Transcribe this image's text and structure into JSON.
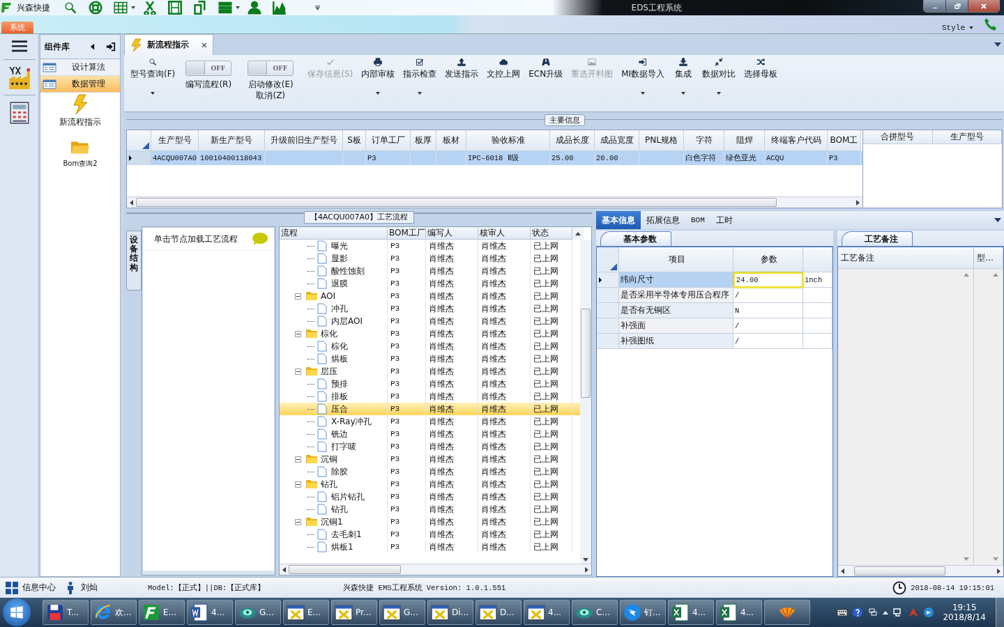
{
  "title_bar": {
    "app_name": "兴森快捷",
    "title": "EDS工程系统"
  },
  "ribbon": {
    "tabs": [
      {
        "label": "系统",
        "selected": true
      }
    ],
    "style_menu": "Style"
  },
  "component_panel": {
    "title": "组件库",
    "groups": [
      {
        "label": "设计算法",
        "selected": false
      },
      {
        "label": "数据管理",
        "selected": true
      }
    ],
    "items": [
      {
        "label": "新流程指示",
        "kind": "flow"
      },
      {
        "label": "Bom查询2",
        "kind": "query"
      }
    ]
  },
  "document_tabs": [
    {
      "label": "新流程指示",
      "selected": true
    }
  ],
  "toolbar": [
    {
      "kind": "button",
      "label": "型号查询(F)",
      "dropdown": true,
      "disabled": false
    },
    {
      "kind": "toggle",
      "label": "编写流程(R)",
      "on": false,
      "state_text": "OFF"
    },
    {
      "kind": "toggle",
      "label": "启动修改(E) 取消(Z)",
      "on": false,
      "state_text": "OFF"
    },
    {
      "kind": "button",
      "label": "保存信息(S)",
      "dropdown": false,
      "disabled": true
    },
    {
      "kind": "button",
      "label": "内部审核",
      "dropdown": true,
      "disabled": false
    },
    {
      "kind": "button",
      "label": "指示检查",
      "dropdown": true,
      "disabled": false
    },
    {
      "kind": "button",
      "label": "发送指示",
      "dropdown": false,
      "disabled": false
    },
    {
      "kind": "button",
      "label": "文控上网",
      "dropdown": false,
      "disabled": false
    },
    {
      "kind": "button",
      "label": "ECN升级",
      "dropdown": false,
      "disabled": false
    },
    {
      "kind": "button",
      "label": "重选开料图",
      "dropdown": false,
      "disabled": true
    },
    {
      "kind": "button",
      "label": "MI数据导入",
      "dropdown": true,
      "disabled": false
    },
    {
      "kind": "button",
      "label": "集成",
      "dropdown": true,
      "disabled": false
    },
    {
      "kind": "button",
      "label": "数据对比",
      "dropdown": true,
      "disabled": false
    },
    {
      "kind": "button",
      "label": "选择母板",
      "dropdown": false,
      "disabled": false
    }
  ],
  "main_info": {
    "legend": "主要信息",
    "columns": [
      "生产型号",
      "新生产型号",
      "升级前旧生产型号",
      "S板",
      "订单工厂",
      "板厚",
      "板材",
      "验收标准",
      "成品长度",
      "成品宽度",
      "PNL规格",
      "字符",
      "阻焊",
      "终端客户代码",
      "BOM工"
    ],
    "rows": [
      {
        "selected": true,
        "cells": [
          "4ACQU007A0",
          "10010400118043",
          null,
          null,
          "P3",
          null,
          null,
          "IPC-6018 Ⅱ级",
          "25.00",
          "20.00",
          null,
          "白色字符",
          "绿色亚光",
          "ACQU",
          "P3"
        ]
      }
    ],
    "side_columns": [
      "合拼型号",
      "生产型号"
    ]
  },
  "flow": {
    "title": "【4ACQU007A0】工艺流程",
    "side_tab": "设备结构",
    "hint": "单击节点加载工艺流程",
    "columns": [
      "流程",
      "BOM工厂",
      "编写人",
      "核审人",
      "状态"
    ],
    "rows": [
      {
        "kind": "step",
        "name": "曝光",
        "factory": "P3",
        "author": "肖维杰",
        "reviewer": "肖维杰",
        "status": "已上网",
        "selected": false
      },
      {
        "kind": "step",
        "name": "显影",
        "factory": "P3",
        "author": "肖维杰",
        "reviewer": "肖维杰",
        "status": "已上网",
        "selected": false
      },
      {
        "kind": "step",
        "name": "酸性蚀刻",
        "factory": "P3",
        "author": "肖维杰",
        "reviewer": "肖维杰",
        "status": "已上网",
        "selected": false
      },
      {
        "kind": "step",
        "name": "退膜",
        "factory": "P3",
        "author": "肖维杰",
        "reviewer": "肖维杰",
        "status": "已上网",
        "selected": false
      },
      {
        "kind": "group",
        "name": "AOI",
        "factory": "P3",
        "author": "肖维杰",
        "reviewer": "肖维杰",
        "status": "已上网",
        "selected": false,
        "expanded": true,
        "children": [
          {
            "kind": "step",
            "name": "冲孔",
            "factory": "P3",
            "author": "肖维杰",
            "reviewer": "肖维杰",
            "status": "已上网",
            "selected": false
          },
          {
            "kind": "step",
            "name": "内层AOI",
            "factory": "P3",
            "author": "肖维杰",
            "reviewer": "肖维杰",
            "status": "已上网",
            "selected": false
          }
        ]
      },
      {
        "kind": "group",
        "name": "棕化",
        "factory": "P3",
        "author": "肖维杰",
        "reviewer": "肖维杰",
        "status": "已上网",
        "selected": false,
        "expanded": true,
        "children": [
          {
            "kind": "step",
            "name": "棕化",
            "factory": "P3",
            "author": "肖维杰",
            "reviewer": "肖维杰",
            "status": "已上网",
            "selected": false
          },
          {
            "kind": "step",
            "name": "烘板",
            "factory": "P3",
            "author": "肖维杰",
            "reviewer": "肖维杰",
            "status": "已上网",
            "selected": false
          }
        ]
      },
      {
        "kind": "group",
        "name": "层压",
        "factory": "P3",
        "author": "肖维杰",
        "reviewer": "肖维杰",
        "status": "已上网",
        "selected": false,
        "expanded": true,
        "children": [
          {
            "kind": "step",
            "name": "预排",
            "factory": "P3",
            "author": "肖维杰",
            "reviewer": "肖维杰",
            "status": "已上网",
            "selected": false
          },
          {
            "kind": "step",
            "name": "排板",
            "factory": "P3",
            "author": "肖维杰",
            "reviewer": "肖维杰",
            "status": "已上网",
            "selected": false
          },
          {
            "kind": "step",
            "name": "压合",
            "factory": "P3",
            "author": "肖维杰",
            "reviewer": "肖维杰",
            "status": "已上网",
            "selected": true
          },
          {
            "kind": "step",
            "name": "X-Ray冲孔",
            "factory": "P3",
            "author": "肖维杰",
            "reviewer": "肖维杰",
            "status": "已上网",
            "selected": false
          },
          {
            "kind": "step",
            "name": "铣边",
            "factory": "P3",
            "author": "肖维杰",
            "reviewer": "肖维杰",
            "status": "已上网",
            "selected": false
          },
          {
            "kind": "step",
            "name": "打字唛",
            "factory": "P3",
            "author": "肖维杰",
            "reviewer": "肖维杰",
            "status": "已上网",
            "selected": false
          }
        ]
      },
      {
        "kind": "group",
        "name": "沉铜",
        "factory": "P3",
        "author": "肖维杰",
        "reviewer": "肖维杰",
        "status": "已上网",
        "selected": false,
        "expanded": true,
        "children": [
          {
            "kind": "step",
            "name": "除胶",
            "factory": "P3",
            "author": "肖维杰",
            "reviewer": "肖维杰",
            "status": "已上网",
            "selected": false
          }
        ]
      },
      {
        "kind": "group",
        "name": "钻孔",
        "factory": "P3",
        "author": "肖维杰",
        "reviewer": "肖维杰",
        "status": "已上网",
        "selected": false,
        "expanded": true,
        "children": [
          {
            "kind": "step",
            "name": "铝片钻孔",
            "factory": "P3",
            "author": "肖维杰",
            "reviewer": "肖维杰",
            "status": "已上网",
            "selected": false
          },
          {
            "kind": "step",
            "name": "钻孔",
            "factory": "P3",
            "author": "肖维杰",
            "reviewer": "肖维杰",
            "status": "已上网",
            "selected": false
          }
        ]
      },
      {
        "kind": "group",
        "name": "沉铜1",
        "factory": "P3",
        "author": "肖维杰",
        "reviewer": "肖维杰",
        "status": "已上网",
        "selected": false,
        "expanded": true,
        "children": [
          {
            "kind": "step",
            "name": "去毛刺1",
            "factory": "P3",
            "author": "肖维杰",
            "reviewer": "肖维杰",
            "status": "已上网",
            "selected": false
          },
          {
            "kind": "step",
            "name": "烘板1",
            "factory": "P3",
            "author": "肖维杰",
            "reviewer": "肖维杰",
            "status": "已上网",
            "selected": false
          }
        ]
      }
    ]
  },
  "detail": {
    "tabs": [
      {
        "label": "基本信息",
        "selected": true
      },
      {
        "label": "拓展信息",
        "selected": false
      },
      {
        "label": "BOM",
        "selected": false
      },
      {
        "label": "工时",
        "selected": false
      }
    ],
    "params": {
      "title": "基本参数",
      "columns": [
        "项目",
        "参数"
      ],
      "rows": [
        {
          "item": "纬向尺寸",
          "value": "24.00",
          "unit": "inch",
          "selected": true,
          "editing": true
        },
        {
          "item": "是否采用半导体专用压合程序",
          "value": "/",
          "selected": false,
          "editing": false
        },
        {
          "item": "是否有无铜区",
          "value": "N",
          "selected": false,
          "editing": false
        },
        {
          "item": "补强面",
          "value": "/",
          "selected": false,
          "editing": false
        },
        {
          "item": "补强图纸",
          "value": "/",
          "selected": false,
          "editing": false
        }
      ]
    },
    "notes": {
      "title": "工艺备注",
      "columns": [
        "工艺备注",
        "型…"
      ]
    }
  },
  "status_bar": {
    "info_center": "信息中心",
    "user": "刘灿",
    "model": "Model:【正式】||DB:【正式库】",
    "version": "兴森快捷 EMS工程系统 Version: 1.0.1.551",
    "datetime": "2018-08-14 19:15:01"
  },
  "taskbar": {
    "items": [
      {
        "kind": "disk",
        "label": "T..."
      },
      {
        "kind": "browser",
        "label": "欢..."
      },
      {
        "kind": "app",
        "label": "E..."
      },
      {
        "kind": "word",
        "label": "4..."
      },
      {
        "kind": "gear",
        "label": "G..."
      },
      {
        "kind": "window",
        "label": "E..."
      },
      {
        "kind": "window",
        "label": "Pr..."
      },
      {
        "kind": "window",
        "label": "G..."
      },
      {
        "kind": "window",
        "label": "Di..."
      },
      {
        "kind": "window",
        "label": "D..."
      },
      {
        "kind": "window",
        "label": "4..."
      },
      {
        "kind": "gear",
        "label": "C..."
      },
      {
        "kind": "bird",
        "label": "钉..."
      },
      {
        "kind": "excel",
        "label": "4..."
      },
      {
        "kind": "excel",
        "label": "4..."
      },
      {
        "kind": "shell"
      }
    ],
    "time": "19:15",
    "date": "2018/8/14"
  }
}
